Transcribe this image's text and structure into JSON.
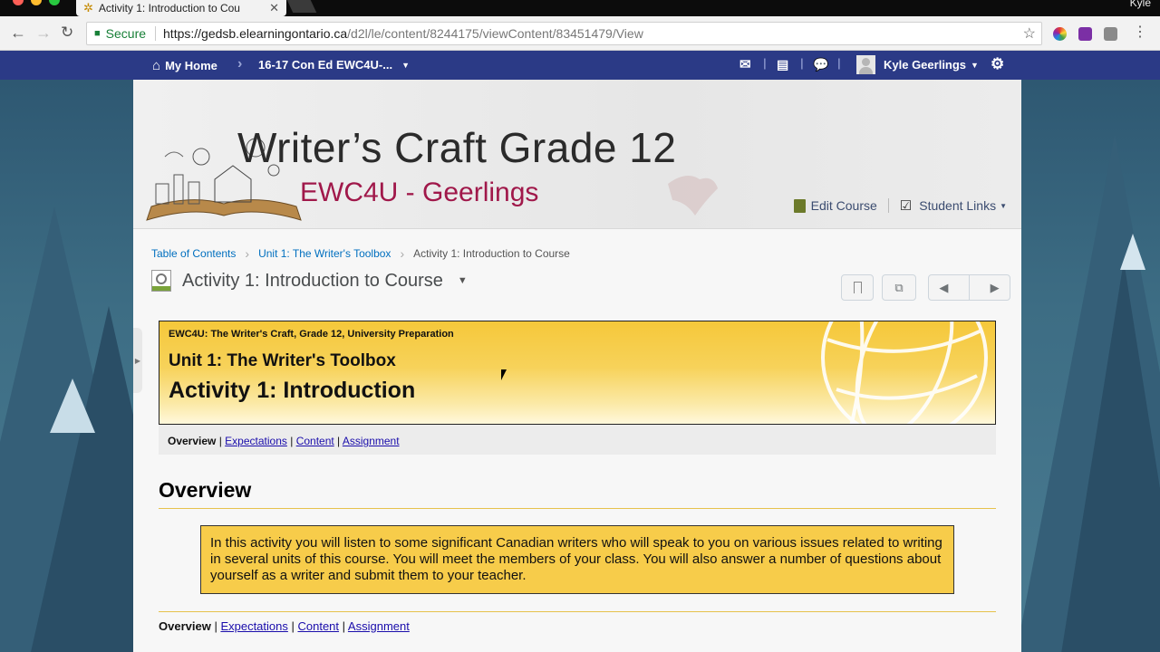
{
  "browser": {
    "tab_title": "Activity 1: Introduction to Cou",
    "user": "Kyle",
    "secure_label": "Secure",
    "url_base": "https://gedsb.elearningontario.ca",
    "url_path": "/d2l/le/content/8244175/viewContent/83451479/View"
  },
  "navbar": {
    "home_label": "My Home",
    "course_label": "16-17 Con Ed EWC4U-...",
    "user_name": "Kyle Geerlings"
  },
  "banner": {
    "title": "Writer’s Craft Grade 12",
    "subtitle": "EWC4U - Geerlings",
    "edit_course": "Edit Course",
    "student_links": "Student Links"
  },
  "breadcrumb": {
    "items": [
      "Table of Contents",
      "Unit 1: The Writer's Toolbox",
      "Activity 1: Introduction to Course"
    ]
  },
  "activity": {
    "title": "Activity 1: Introduction to Course"
  },
  "content": {
    "course_line": "EWC4U: The Writer's Craft, Grade 12, University Preparation",
    "unit": "Unit 1: The Writer's Toolbox",
    "activity": "Activity 1: Introduction",
    "tabs": {
      "overview": "Overview",
      "expectations": "Expectations",
      "content": "Content",
      "assignment": "Assignment",
      "separator": " | "
    },
    "overview_heading": "Overview",
    "overview_text": "In this activity you will listen to some significant Canadian writers who will speak to you on various issues related to writing in several units of this course. You will meet the members of your class. You will also answer a number of questions about yourself as a writer and submit them to your teacher."
  },
  "colors": {
    "navbar": "#2b3a86",
    "highlight_box": "#f7cc4a",
    "link": "#006fbf",
    "subtitle": "#a0184a"
  }
}
